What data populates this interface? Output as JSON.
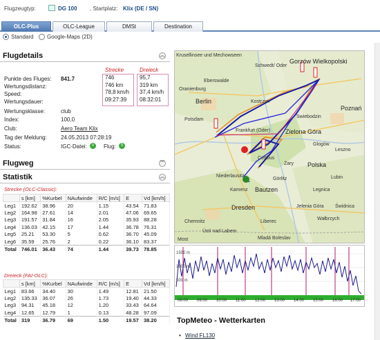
{
  "header": {
    "aircraft_label": "Flugzeugtyp:",
    "aircraft": "DG 100",
    "startplace_label": ", Startplatz:",
    "startplace": "Klix (DE / SN)"
  },
  "tabs": [
    {
      "label": "OLC-Plus",
      "active": true
    },
    {
      "label": "OLC-League",
      "active": false
    },
    {
      "label": "DMSt",
      "active": false
    },
    {
      "label": "Destination",
      "active": false
    }
  ],
  "view_options": [
    {
      "label": "Standard",
      "selected": true
    },
    {
      "label": "Google-Maps (2D)",
      "selected": false
    }
  ],
  "flugdetails": {
    "title": "Flugdetails",
    "strecke_header": "Strecke",
    "dreieck_header": "Dreieck",
    "rows": [
      {
        "label": "Punkte des Fluges:",
        "value": "841.7"
      },
      {
        "label": "Wertungsdistanz:",
        "value": ""
      },
      {
        "label": "Speed:",
        "value": ""
      },
      {
        "label": "Wertungsdauer:",
        "value": ""
      },
      {
        "label": "Wertungsklasse:",
        "value": "club"
      },
      {
        "label": "Index:",
        "value": "100,0"
      },
      {
        "label": "Club:",
        "value": "Aero Team Klix"
      },
      {
        "label": "Tag der Meldung:",
        "value": "24.05.2013 07:28:19"
      },
      {
        "label": "Status:",
        "value": ""
      }
    ],
    "strecke_values": [
      "746",
      "746 km",
      "78,8 km/h",
      "09:27:39"
    ],
    "dreieck_values": [
      "95,7",
      "319 km",
      "37,4 km/h",
      "08:32:01"
    ],
    "status": {
      "igc_label": "IGC-Datei:",
      "igc_icon": "V",
      "flug_label": "Flug:",
      "flug_icon": "S"
    }
  },
  "flugweg": {
    "title": "Flugweg"
  },
  "statistik": {
    "title": "Statistik",
    "classic": {
      "caption": "Strecke (OLC-Classic):",
      "headers": [
        "",
        "s [km]",
        "%Kurbel",
        "NAufwinde",
        "R/C [m/s]",
        "E",
        "Vd [km/h]"
      ],
      "rows": [
        [
          "Leg1",
          "192.62",
          "38.96",
          "20",
          "1.15",
          "43.54",
          "71.83"
        ],
        [
          "Leg2",
          "164.98",
          "27.61",
          "14",
          "2.01",
          "47.06",
          "69.65"
        ],
        [
          "Leg3",
          "191.57",
          "31.84",
          "16",
          "2.05",
          "35.93",
          "88.28"
        ],
        [
          "Leg4",
          "136.03",
          "42.15",
          "17",
          "1.44",
          "36.78",
          "76.31"
        ],
        [
          "Leg5",
          "25.21",
          "53.30",
          "5",
          "0.62",
          "36.70",
          "45.09"
        ],
        [
          "Leg6",
          "35.59",
          "25.76",
          "2",
          "0.22",
          "36.10",
          "83.37"
        ]
      ],
      "total": [
        "Total",
        "746.01",
        "36.43",
        "74",
        "1.44",
        "39.73",
        "78.85"
      ]
    },
    "fai": {
      "caption": "Dreieck (FAI-OLC):",
      "headers": [
        "",
        "s [km]",
        "%Kurbel",
        "NAufwinde",
        "R/C [m/s]",
        "E",
        "Vd [km/h]"
      ],
      "rows": [
        [
          "Leg1",
          "83.66",
          "34.40",
          "30",
          "1.49",
          "12.81",
          "21.50"
        ],
        [
          "Leg2",
          "135.33",
          "36.07",
          "26",
          "1.73",
          "19.40",
          "44.33"
        ],
        [
          "Leg3",
          "94.31",
          "45.18",
          "12",
          "1.20",
          "33.43",
          "64.64"
        ],
        [
          "Leg4",
          "12.65",
          "12.79",
          "1",
          "0.13",
          "48.28",
          "97.09"
        ]
      ],
      "total": [
        "Total",
        "319",
        "36.79",
        "69",
        "1.50",
        "19.57",
        "38.20"
      ]
    }
  },
  "map": {
    "labels": [
      "Krusellinsee und Mechowseen",
      "Schwedt/ Oder",
      "Gorzów Wielkopolski",
      "Eberswalde",
      "Oranienburg",
      "Berlin",
      "Frankfurt (Oder)",
      "Poznań",
      "Kostrzyn",
      "Cottbus",
      "Zielona Góra",
      "Leszno",
      "Bautzen",
      "Legnica",
      "Dresden",
      "Chemnitz",
      "Jelenia Góra",
      "Wałbrzych",
      "Kamenz",
      "Görlitz",
      "Ústí nad Labem",
      "Liberec",
      "Polska",
      "Mladá Boleslav",
      "Niederlausitz",
      "Glogów",
      "Lubin",
      "Świdnica",
      "Żary",
      "Swiebodzin",
      "Potsdam",
      "Most"
    ],
    "credit": "Kartendaten ©2013 GeoBasis-DE/BKG (©2009), Google"
  },
  "barogram": {
    "y_labels": [
      "1500 m",
      "1000 m",
      "500 m"
    ],
    "x_labels": [
      "08:00",
      "09:00",
      "10:00",
      "11:00",
      "12:00",
      "13:00",
      "14:00",
      "15:00",
      "16:00",
      "17:00"
    ]
  },
  "topmeteo": {
    "title": "TopMeteo - Wetterkarten",
    "link": "Wind FL130"
  },
  "colors": {
    "tab_active": "#4f78b0",
    "highlight_pink": "#d58cb0",
    "caption_red": "#cc2222",
    "track_blue": "#1a1aa8",
    "track_orange": "#e0902a"
  }
}
